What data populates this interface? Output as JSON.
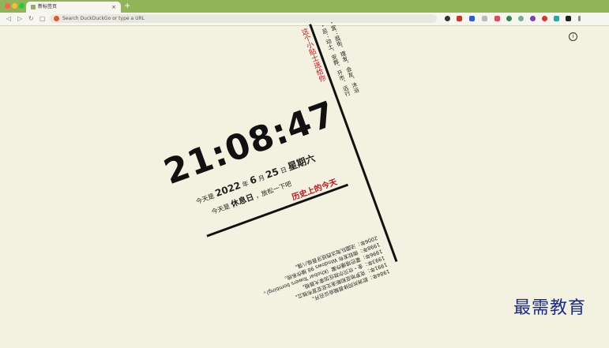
{
  "browser": {
    "tab_title": "新标签页",
    "tab_close": "×",
    "new_tab": "+",
    "address_placeholder": "Search DuckDuckGo or type a URL",
    "colors": {
      "chrome": "#8fb558",
      "close_dot": "#ff5f57",
      "min_dot": "#febc2e",
      "max_dot": "#28c840"
    }
  },
  "page": {
    "time": "21:08:47",
    "date_prefix": "今天是",
    "year": "2022",
    "year_unit": "年",
    "month": "6",
    "month_unit": "月",
    "day": "25",
    "day_unit": "日",
    "weekday": "星期六",
    "rest_prefix": "今天是",
    "rest_day": "休息日",
    "rest_suffix": "，放松一下吧",
    "history_title": "历史上的今天",
    "history_items": [
      "1984年：欧洲共同体首脑会议召开。",
      "1991年：克罗地亚和斯洛文尼亚宣布独立。",
      "1993年：金・坎贝尔就任加拿大首相。",
      "1996年：霍巴塔爆炸案（Khobar Towers bombing）。",
      "1998年：微软发布 Windows 98 操作系统。",
      "2006年：法国队淘汰西班牙晋级八强。"
    ],
    "side_title": "这个小贴士送给你",
    "side_items": [
      "・宜：逛街、理发、会友、沐浴",
      "・忌：动土、安葬、开市、远行"
    ],
    "watermark": "最需教育",
    "info_glyph": "i"
  }
}
